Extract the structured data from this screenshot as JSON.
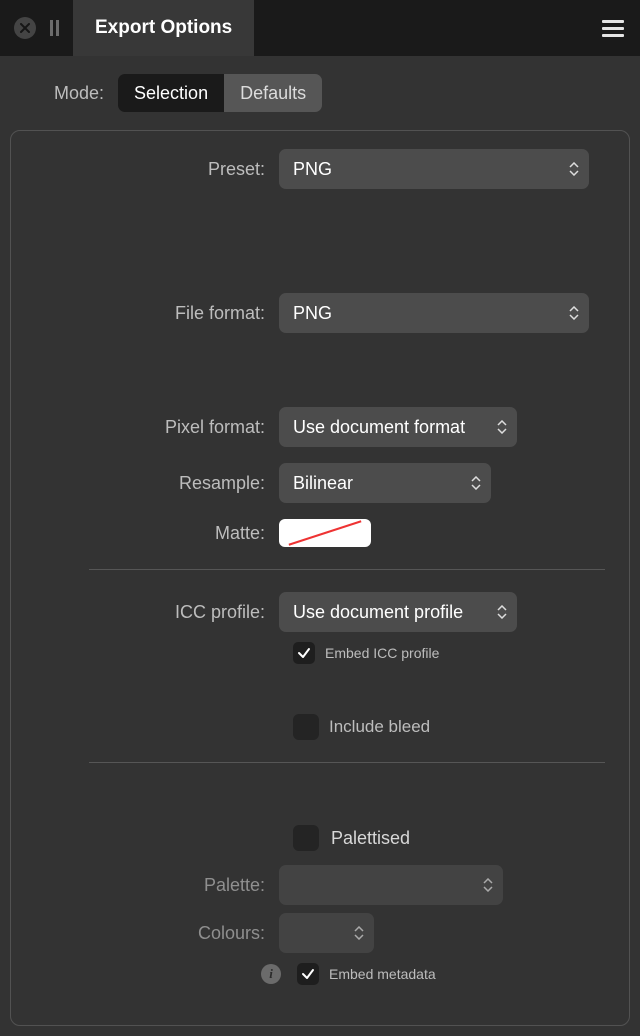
{
  "header": {
    "title": "Export Options"
  },
  "mode": {
    "label": "Mode:",
    "selection": "Selection",
    "defaults": "Defaults"
  },
  "form": {
    "preset_label": "Preset:",
    "preset_value": "PNG",
    "file_format_label": "File format:",
    "file_format_value": "PNG",
    "pixel_format_label": "Pixel format:",
    "pixel_format_value": "Use document format",
    "resample_label": "Resample:",
    "resample_value": "Bilinear",
    "matte_label": "Matte:",
    "icc_profile_label": "ICC profile:",
    "icc_profile_value": "Use document profile",
    "embed_icc_label": "Embed ICC profile",
    "include_bleed_label": "Include bleed",
    "palettised_label": "Palettised",
    "palette_label": "Palette:",
    "palette_value": "",
    "colours_label": "Colours:",
    "colours_value": "",
    "embed_metadata_label": "Embed metadata"
  },
  "state": {
    "embed_icc_checked": true,
    "include_bleed_checked": false,
    "palettised_checked": false,
    "embed_metadata_checked": true
  }
}
